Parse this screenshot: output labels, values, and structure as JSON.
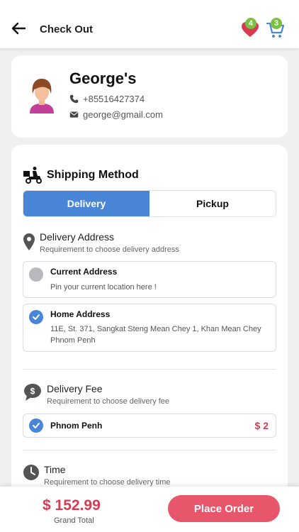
{
  "header": {
    "title": "Check Out",
    "wishlist_count": "4",
    "cart_count": "3"
  },
  "profile": {
    "name": "George's",
    "phone": "+85516427374",
    "email": "george@gmail.com"
  },
  "shipping": {
    "title": "Shipping Method",
    "tabs": [
      {
        "label": "Delivery",
        "active": true
      },
      {
        "label": "Pickup",
        "active": false
      }
    ]
  },
  "delivery_address": {
    "title": "Delivery Address",
    "subtitle": "Requirement to choose delivery address",
    "options": [
      {
        "title": "Current Address",
        "detail": "Pin your current location here !",
        "selected": false
      },
      {
        "title": "Home Address",
        "detail": "11E, St. 371, Sangkat Steng Mean Chey 1, Khan Mean Chey Phnom Penh",
        "selected": true
      }
    ]
  },
  "delivery_fee": {
    "title": "Delivery Fee",
    "subtitle": "Requirement to choose delivery fee",
    "option": {
      "title": "Phnom Penh",
      "price": "$ 2",
      "selected": true
    }
  },
  "time": {
    "title": "Time",
    "subtitle": "Requirement to choose delivery time"
  },
  "footer": {
    "grand_total": "$ 152.99",
    "grand_total_label": "Grand Total",
    "place_order_label": "Place Order"
  },
  "colors": {
    "accent_blue": "#4a86d8",
    "price_red": "#d43c54",
    "button_red": "#e8566b",
    "badge_green": "#7ac143"
  }
}
